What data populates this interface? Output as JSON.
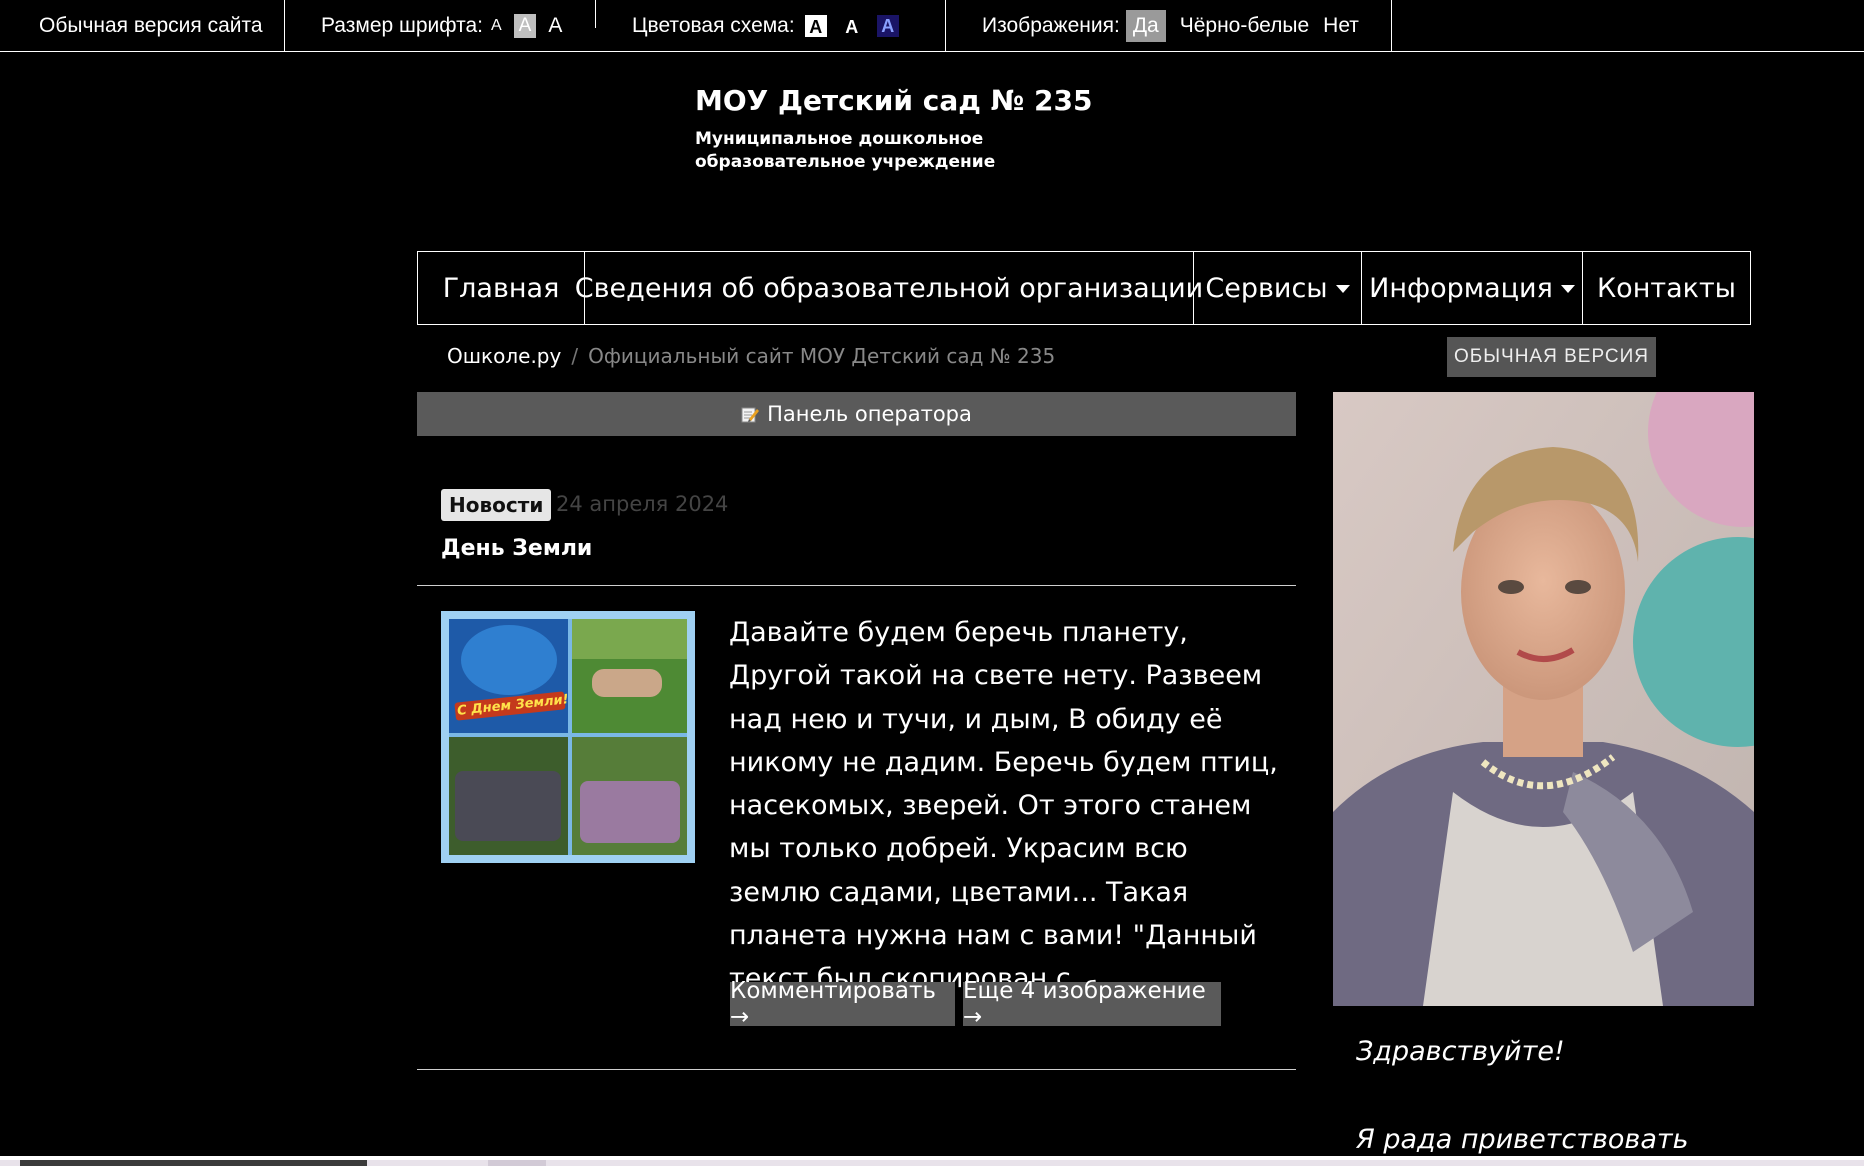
{
  "a11y_bar": {
    "normal_version": "Обычная версия сайта",
    "font_size_label": "Размер шрифта:",
    "font_size_small": "A",
    "font_size_mid": "A",
    "font_size_big": "A",
    "color_scheme_label": "Цветовая схема:",
    "scheme_1": "A",
    "scheme_2": "A",
    "scheme_3": "A",
    "images_label": "Изображения:",
    "images_yes": "Да",
    "images_bw": "Чёрно-белые",
    "images_no": "Нет"
  },
  "header": {
    "title": "МОУ Детский сад № 235",
    "subtitle": "Муниципальное дошкольное образовательное учреждение"
  },
  "nav": {
    "items": [
      {
        "label": "Главная"
      },
      {
        "label": "Сведения об образовательной организации"
      },
      {
        "label": "Сервисы",
        "dropdown": true
      },
      {
        "label": "Информация",
        "dropdown": true
      },
      {
        "label": "Контакты"
      }
    ]
  },
  "breadcrumb": {
    "home": "Ошколе.ру",
    "separator": "/",
    "current": "Официальный сайт МОУ Детский сад № 235"
  },
  "normal_version_button": "ОБЫЧНАЯ ВЕРСИЯ",
  "operator_panel": "Панель оператора",
  "news": {
    "badge": "Новости",
    "date": "24 апреля 2024",
    "title": "День Земли",
    "text": "Давайте будем беречь планету, Другой такой на свете нету. Развеем над нею и тучи, и дым, В обиду её никому не дадим. Беречь будем птиц, насекомых, зверей. От этого станем мы только добрей. Украсим всю землю садами, цветами... Такая планета нужна нам с вами! \"Данный текст был скопирован с...",
    "comment_button": "Комментировать →",
    "more_images_button": "Еще 4 изображение →",
    "thumb_caption": "С Днем Земли!"
  },
  "sidebar": {
    "greeting": "Здравствуйте!",
    "welcome": "Я рада приветствовать"
  },
  "colors": {
    "background": "#000000",
    "text": "#ffffff",
    "button_bg": "#5a5a5a",
    "badge_bg": "#e6e6e6"
  }
}
